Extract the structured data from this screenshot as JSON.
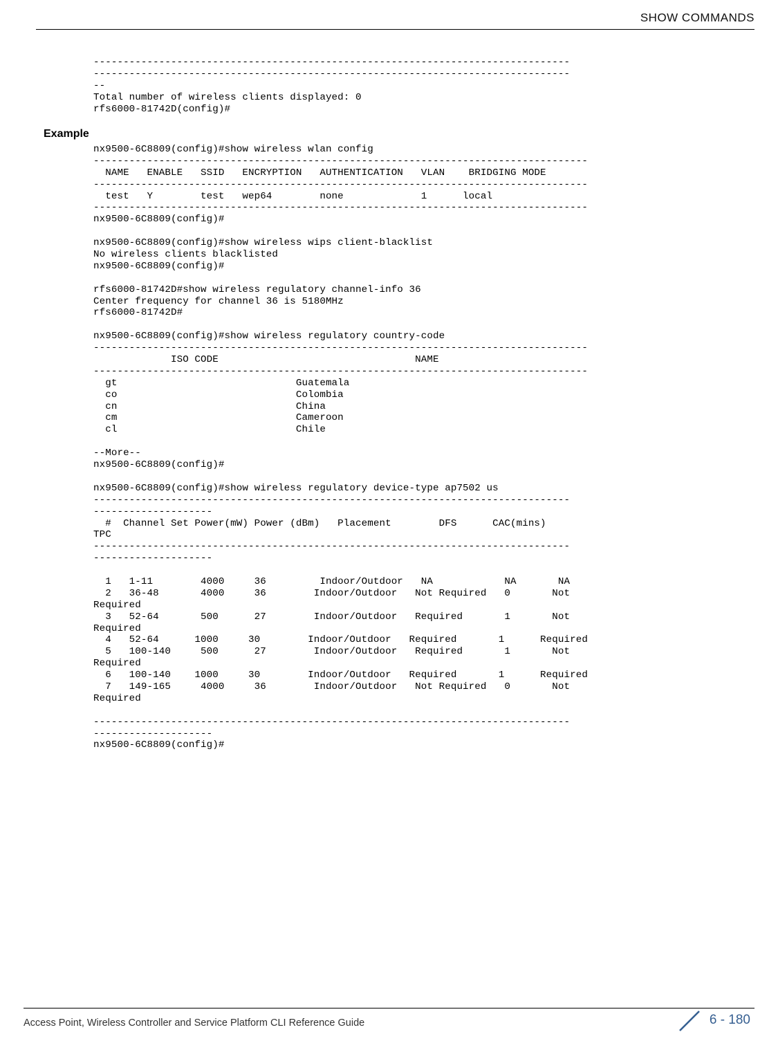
{
  "header": {
    "title": "SHOW COMMANDS"
  },
  "example_label": "Example",
  "code": {
    "block1": "--------------------------------------------------------------------------------\n--------------------------------------------------------------------------------\n--\nTotal number of wireless clients displayed: 0\nrfs6000-81742D(config)#",
    "block2": "nx9500-6C8809(config)#show wireless wlan config\n-----------------------------------------------------------------------------------\n  NAME   ENABLE   SSID   ENCRYPTION   AUTHENTICATION   VLAN    BRIDGING MODE\n-----------------------------------------------------------------------------------\n  test   Y        test   wep64        none             1      local\n-----------------------------------------------------------------------------------\nnx9500-6C8809(config)#\n\nnx9500-6C8809(config)#show wireless wips client-blacklist\nNo wireless clients blacklisted\nnx9500-6C8809(config)#\n\nrfs6000-81742D#show wireless regulatory channel-info 36\nCenter frequency for channel 36 is 5180MHz\nrfs6000-81742D#\n\nnx9500-6C8809(config)#show wireless regulatory country-code\n-----------------------------------------------------------------------------------\n             ISO CODE                                 NAME\n-----------------------------------------------------------------------------------\n  gt                              Guatemala\n  co                              Colombia\n  cn                              China\n  cm                              Cameroon\n  cl                              Chile\n\n--More--\nnx9500-6C8809(config)#\n\nnx9500-6C8809(config)#show wireless regulatory device-type ap7502 us\n--------------------------------------------------------------------------------\n--------------------\n  #  Channel Set Power(mW) Power (dBm)   Placement        DFS      CAC(mins)   \nTPC\n--------------------------------------------------------------------------------\n--------------------\n\n  1   1-11        4000     36         Indoor/Outdoor   NA            NA       NA\n  2   36-48       4000     36        Indoor/Outdoor   Not Required   0       Not \nRequired\n  3   52-64       500      27        Indoor/Outdoor   Required       1       Not \nRequired\n  4   52-64      1000     30        Indoor/Outdoor   Required       1      Required\n  5   100-140     500      27        Indoor/Outdoor   Required       1       Not \nRequired\n  6   100-140    1000     30        Indoor/Outdoor   Required       1      Required\n  7   149-165     4000     36        Indoor/Outdoor   Not Required   0       Not \nRequired\n\n--------------------------------------------------------------------------------\n--------------------\nnx9500-6C8809(config)#"
  },
  "footer": {
    "text": "Access Point, Wireless Controller and Service Platform CLI Reference Guide",
    "page": "6 - 180"
  }
}
